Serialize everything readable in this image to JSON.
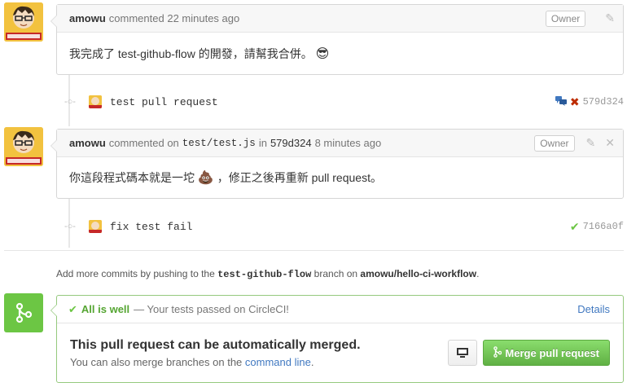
{
  "comments": [
    {
      "author": "amowu",
      "action": "commented",
      "time": "22 minutes ago",
      "badge": "Owner",
      "body": "我完成了 test-github-flow 的開發，請幫我合併。",
      "emoji": "😎"
    },
    {
      "author": "amowu",
      "action": "commented on",
      "path": "test/test.js",
      "in_word": "in",
      "sha": "579d324",
      "time": "8 minutes ago",
      "badge": "Owner",
      "body_before": "你這段程式碼本就是一坨",
      "emoji": "💩",
      "body_after": "，修正之後再重新 pull request。"
    }
  ],
  "commits": [
    {
      "message": "test pull request",
      "sha": "579d324",
      "status": "failed"
    },
    {
      "message": "fix test fail",
      "sha": "7166a0f",
      "status": "passed"
    }
  ],
  "push_hint": {
    "prefix": "Add more commits by pushing to the",
    "branch": "test-github-flow",
    "middle": "branch on",
    "repo": "amowu/hello-ci-workflow",
    "suffix": "."
  },
  "merge": {
    "status_title": "All is well",
    "status_desc": "— Your tests passed on CircleCI!",
    "details_label": "Details",
    "headline": "This pull request can be automatically merged.",
    "sub_prefix": "You can also merge branches on the",
    "sub_link": "command line",
    "sub_suffix": ".",
    "button_label": "Merge pull request"
  },
  "colors": {
    "success": "#6cc644",
    "fail": "#bd2c00",
    "link": "#4078c0"
  }
}
